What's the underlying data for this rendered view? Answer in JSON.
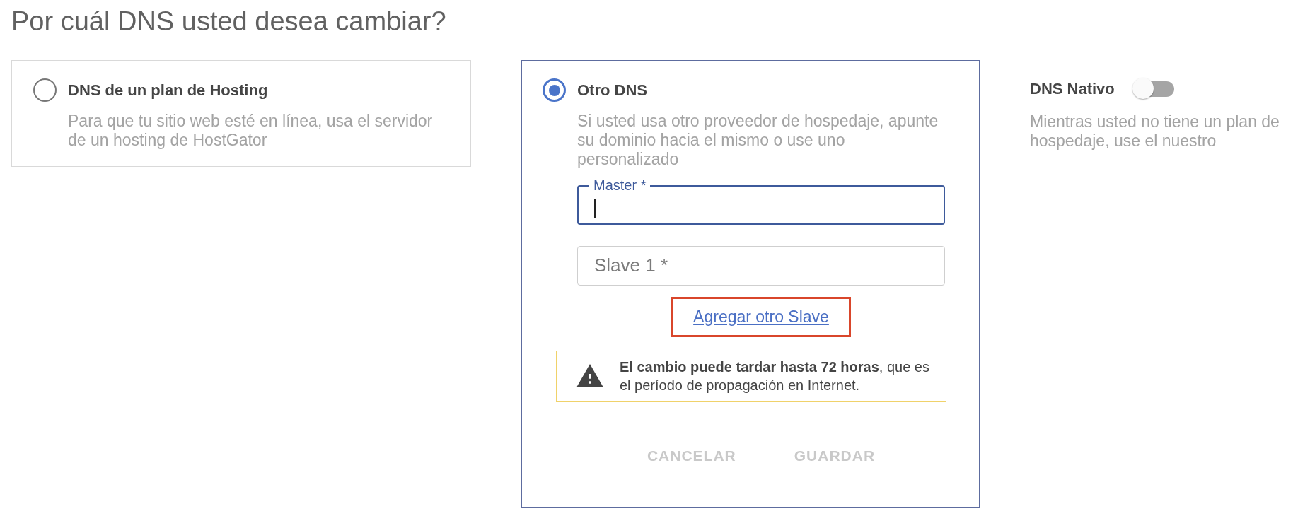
{
  "heading": "Por cuál DNS usted desea cambiar?",
  "options": [
    {
      "kind": "radio",
      "label": "DNS de un plan de Hosting",
      "description": "Para que tu sitio web esté en línea, usa el servidor de un hosting de HostGator",
      "selected": false
    },
    {
      "kind": "radio",
      "label": "Otro DNS",
      "description": "Si usted usa otro proveedor de hospedaje, apunte su dominio hacia el mismo o use uno personalizado",
      "selected": true,
      "fields": [
        {
          "label": "Master *",
          "focused": true
        },
        {
          "label": "Slave 1 *",
          "focused": false
        }
      ],
      "add_link": {
        "label": "Agregar otro Slave",
        "highlighted": true
      },
      "notice": "**El cambio puede tardar hasta 72 horas**, que es el período de propagación en Internet.",
      "buttons": [
        {
          "label": "CANCELAR",
          "disabled": true
        },
        {
          "label": "GUARDAR",
          "disabled": true
        }
      ]
    },
    {
      "kind": "toggle",
      "label": "DNS Nativo",
      "description": "Mientras usted no tiene un plan de hospedaje, use el nuestro",
      "on": false
    }
  ]
}
